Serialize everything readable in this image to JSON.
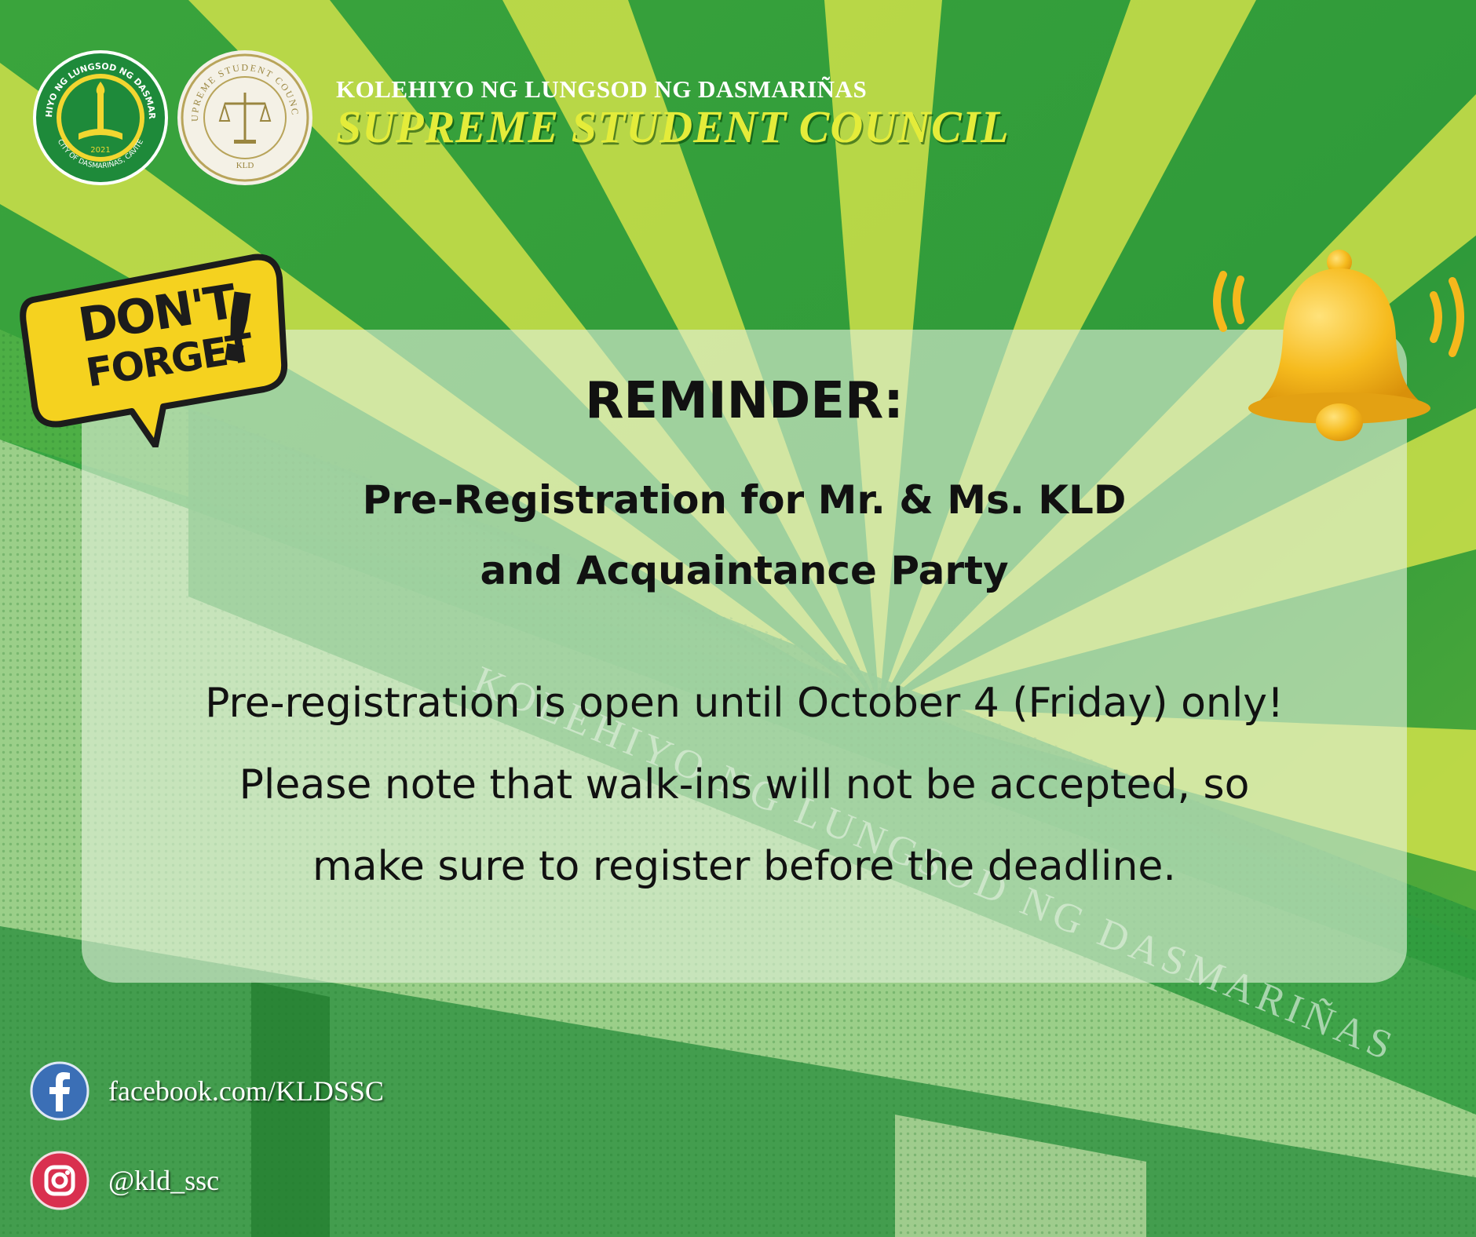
{
  "header": {
    "college_name": "KOLEHIYO NG LUNGSOD NG DASMARIÑAS",
    "council_name": "SUPREME STUDENT COUNCIL",
    "kld_logo_text": [
      "KOLEHIYO NG LUNGSOD NG DASMARIÑAS",
      "CITY OF DASMARIÑAS, CAVITE",
      "2021"
    ],
    "ssc_logo_text": [
      "SUPREME STUDENT COUNCIL",
      "KLD"
    ]
  },
  "badge": {
    "line1": "DON'T",
    "line2": "FORGET",
    "mark": "!"
  },
  "announcement": {
    "heading": "REMINDER:",
    "subtitle_lines": [
      "Pre-Registration for Mr. & Ms. KLD",
      "and Acquaintance Party"
    ],
    "body_lines": [
      "Pre-registration is open until October 4 (Friday) only!",
      "Please note that walk-ins will not be accepted, so",
      "make sure to register before the deadline."
    ]
  },
  "building_sign_text": "KOLEHIYO NG LUNGSOD NG DASMARIÑAS",
  "social": {
    "facebook": {
      "icon": "facebook-icon",
      "text": "facebook.com/KLDSSC"
    },
    "instagram": {
      "icon": "instagram-icon",
      "text": "@kld_ssc"
    }
  },
  "colors": {
    "background_green": "#2e9e3e",
    "ray_yellow": "#dde04a",
    "council_title": "#e4ec3a",
    "badge_yellow": "#f5d21f",
    "bell_gold": "#f2b51a",
    "facebook_blue": "#3b6fb6",
    "instagram_red": "#d9304f"
  }
}
